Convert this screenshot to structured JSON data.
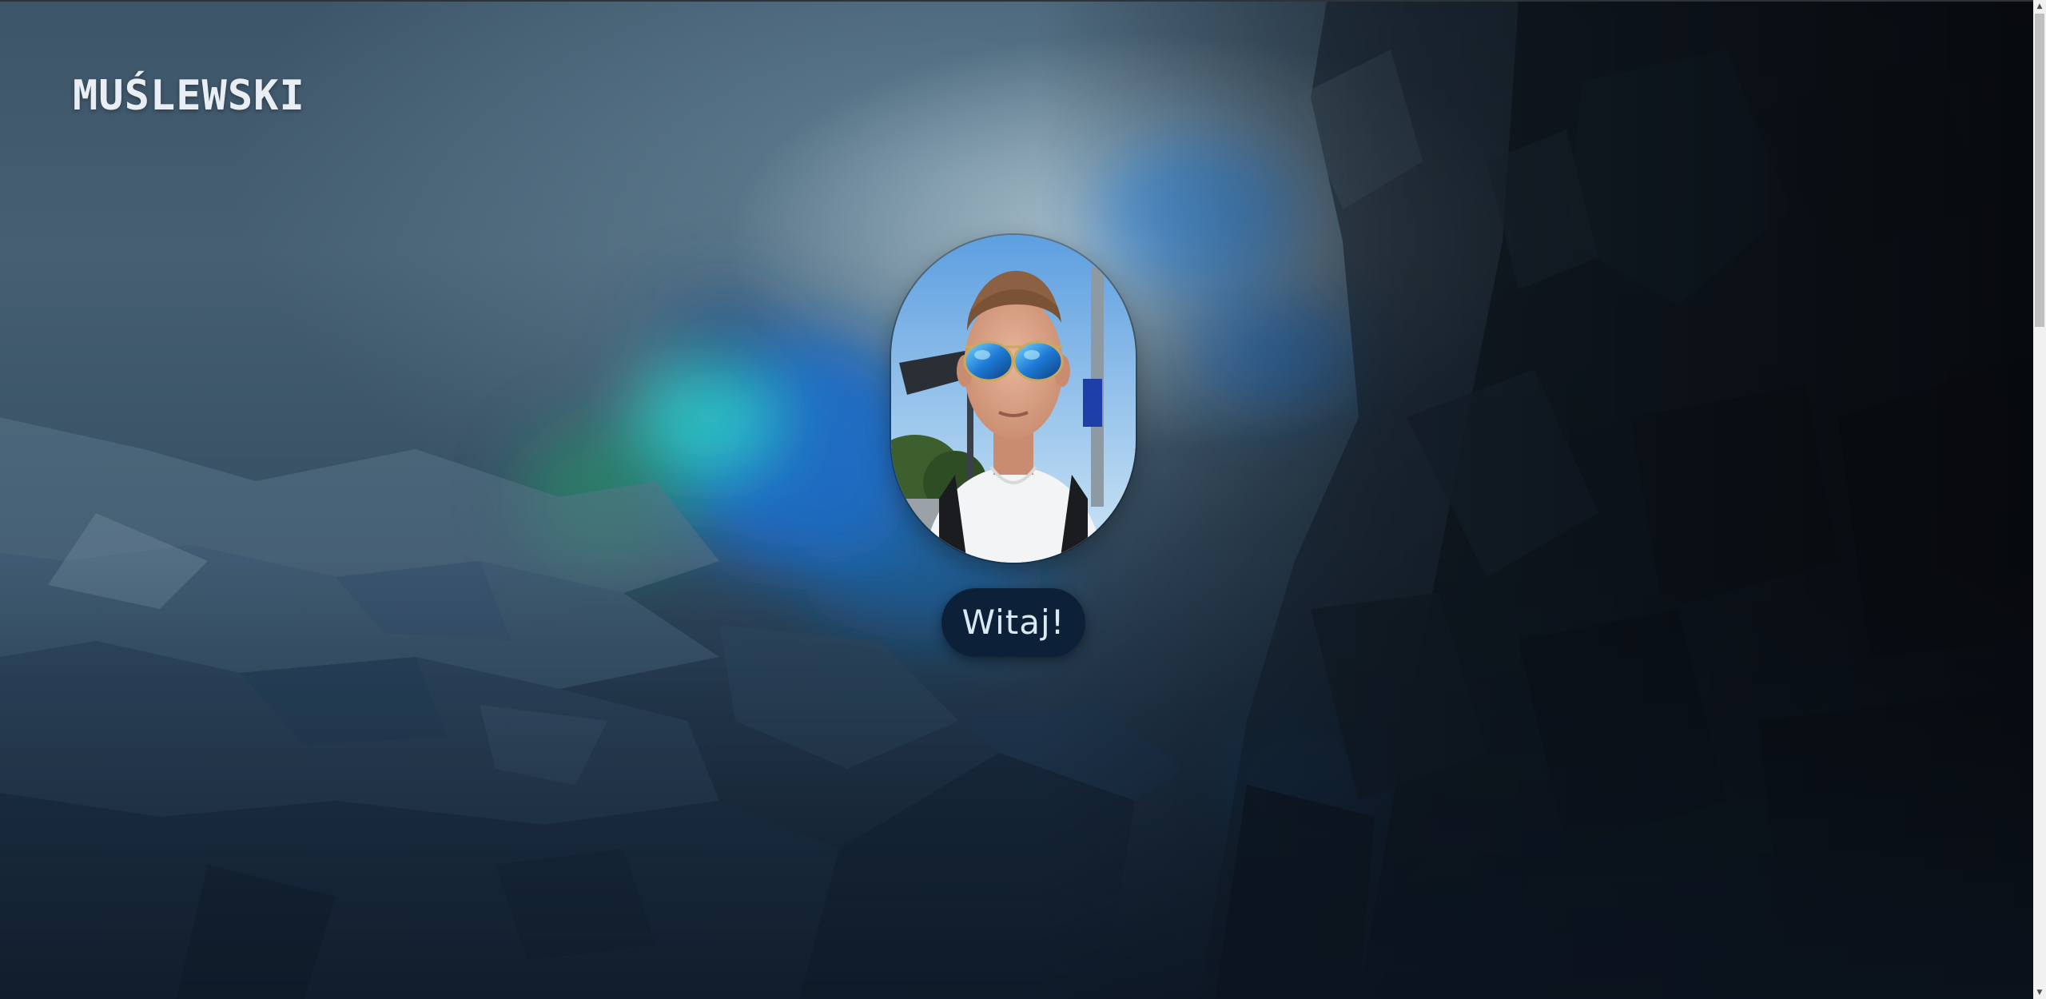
{
  "header": {
    "logo_text": "MUŚLEWSKI"
  },
  "hero": {
    "avatar_icon": "profile-photo",
    "welcome_label": "Witaj!"
  },
  "scrollbar": {
    "up_arrow": "▲",
    "down_arrow": "▼"
  },
  "colors": {
    "button_bg": "#0c2138",
    "button_text": "#dbe9f5",
    "logo_text": "#e8eef3",
    "accent_glow": "#1e8fe0"
  }
}
